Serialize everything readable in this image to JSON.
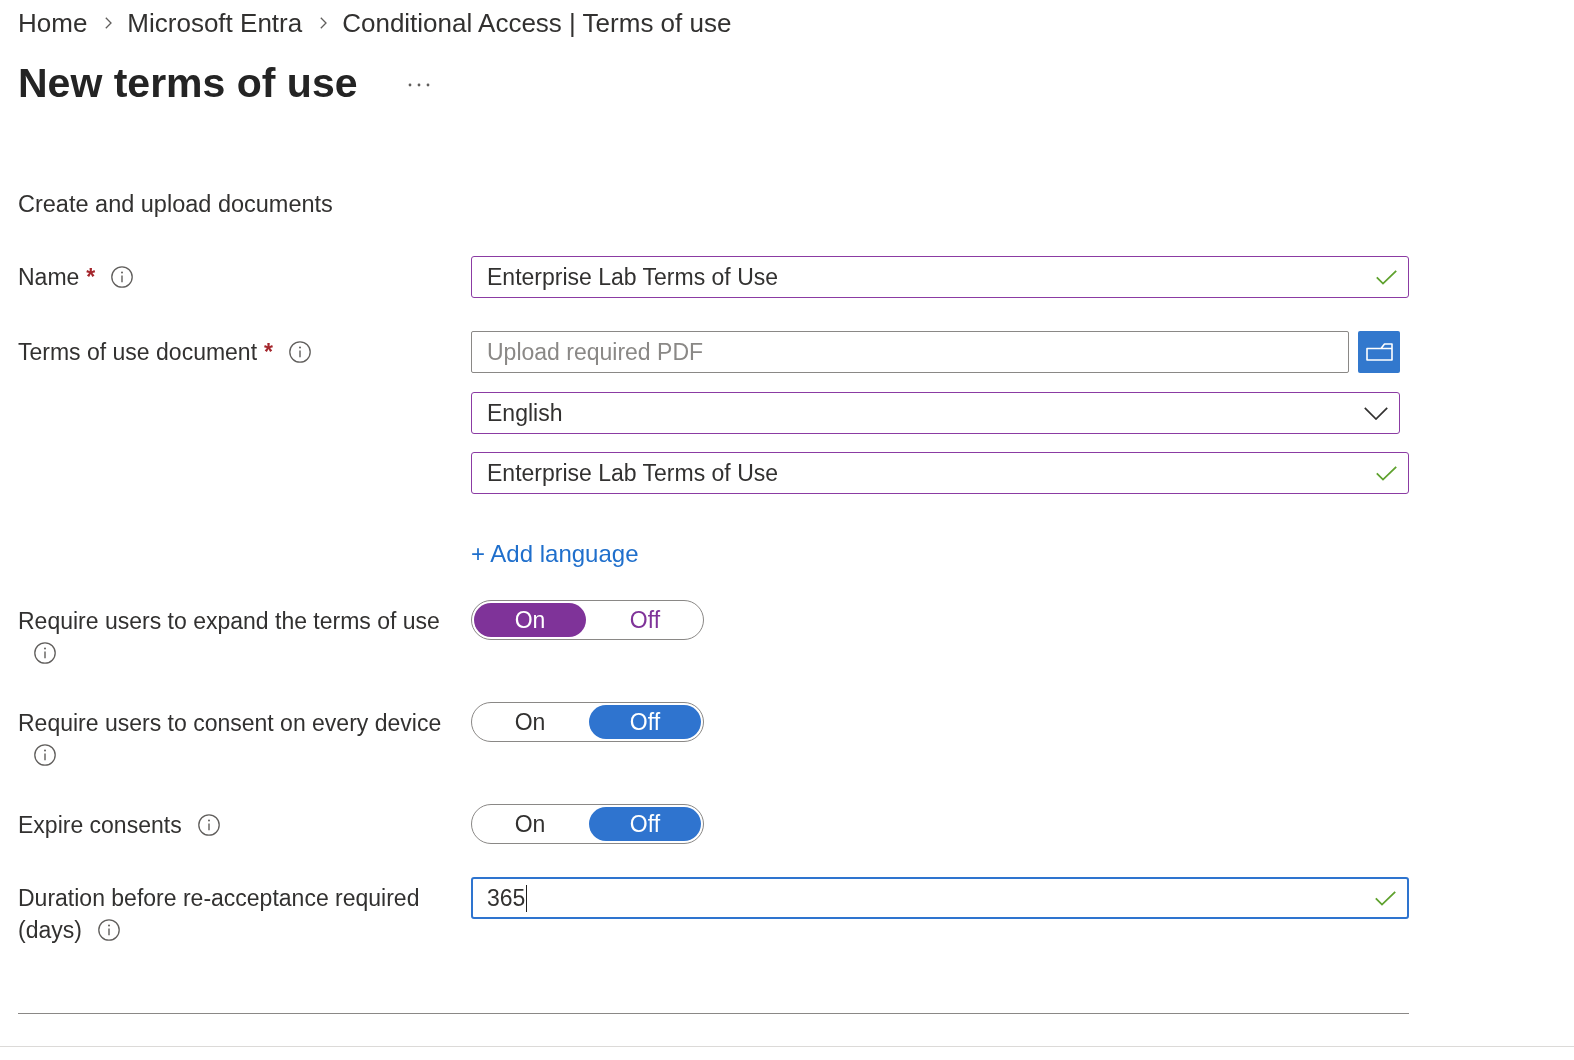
{
  "breadcrumb": [
    {
      "label": "Home"
    },
    {
      "label": "Microsoft Entra"
    },
    {
      "label": "Conditional Access | Terms of use"
    }
  ],
  "page": {
    "title": "New terms of use"
  },
  "section": {
    "heading": "Create and upload documents"
  },
  "form": [
    {
      "kind": "text",
      "label": [
        "Name"
      ],
      "required_mark": "*",
      "value": "Enterprise Lab Terms of Use",
      "modified": true,
      "valid": true
    },
    {
      "kind": "document",
      "label": [
        "Terms of use document"
      ],
      "required_mark": "*",
      "upload": {
        "placeholder": "Upload required PDF",
        "modified": false
      },
      "language": {
        "value": "English",
        "modified": true
      },
      "display_name": {
        "value": "Enterprise Lab Terms of Use",
        "modified": true,
        "valid": true
      },
      "add_language": "+ Add language"
    },
    {
      "kind": "toggle",
      "label": [
        "Require users to expand the terms of use"
      ],
      "modified": true,
      "options": [
        {
          "label": "On",
          "selected": true
        },
        {
          "label": "Off",
          "selected": false
        }
      ]
    },
    {
      "kind": "toggle",
      "label": [
        "Require users to consent on every device"
      ],
      "modified": false,
      "options": [
        {
          "label": "On",
          "selected": false
        },
        {
          "label": "Off",
          "selected": true
        }
      ]
    },
    {
      "kind": "toggle",
      "label": [
        "Expire consents"
      ],
      "modified": false,
      "options": [
        {
          "label": "On",
          "selected": false
        },
        {
          "label": "Off",
          "selected": true
        }
      ]
    },
    {
      "kind": "text",
      "label": [
        "Duration before re-acceptance required",
        "(days)"
      ],
      "value": "365",
      "focused": true,
      "valid": true
    }
  ]
}
